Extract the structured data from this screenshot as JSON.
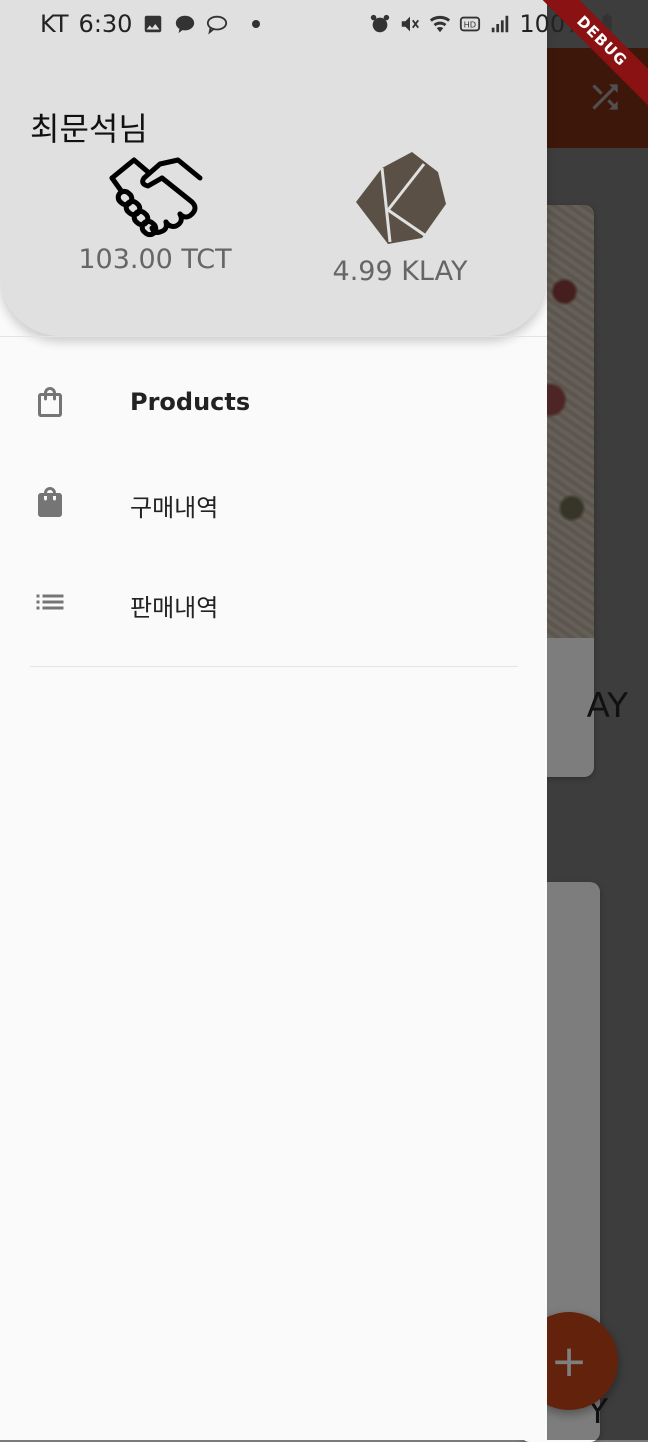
{
  "status_bar": {
    "carrier": "KT",
    "time": "6:30",
    "battery": "100%"
  },
  "debug_banner": "DEBUG",
  "background": {
    "card_price_partial": "AY",
    "card2_price_partial": "Y",
    "fab_label": "+"
  },
  "drawer": {
    "user_name": "최문석님",
    "token_balance": "103.00 TCT",
    "klay_balance": "4.99 KLAY",
    "menu": [
      {
        "label": "Products",
        "icon": "shopping-bag-outline-icon"
      },
      {
        "label": "구매내역",
        "icon": "shopping-bag-icon"
      },
      {
        "label": "판매내역",
        "icon": "list-icon"
      }
    ]
  },
  "colors": {
    "appbar": "#c2410c",
    "drawer_header": "#e0e0e0",
    "drawer_body": "#fafafa",
    "fab": "#c64516"
  }
}
